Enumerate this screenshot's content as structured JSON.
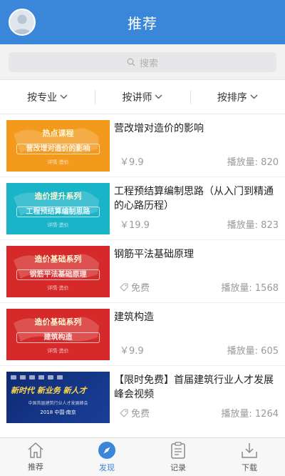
{
  "header": {
    "title": "推荐"
  },
  "search": {
    "placeholder": "搜索"
  },
  "filters": [
    {
      "label": "按专业"
    },
    {
      "label": "按讲师"
    },
    {
      "label": "按排序"
    }
  ],
  "courses": [
    {
      "title": "营改增对造价的影响",
      "price": "￥9.9",
      "plays": "播放量: 820",
      "thumb": {
        "series": "热点课程",
        "caption": "营改增对造价的影响",
        "footer": "详情·造价",
        "color": "#f39a1d"
      }
    },
    {
      "title": "工程预结算编制思路（从入门到精通的心路历程）",
      "price": "￥19.9",
      "plays": "播放量: 823",
      "thumb": {
        "series": "造价提升系列",
        "caption": "工程预结算编制思路",
        "footer": "详情·造价",
        "color": "#19b4c8"
      }
    },
    {
      "title": "钢筋平法基础原理",
      "price": "免费",
      "plays": "播放量: 1568",
      "thumb": {
        "series": "造价基础系列",
        "caption": "钢筋平法基础原理",
        "footer": "详情·造价",
        "color": "#d62a2a"
      }
    },
    {
      "title": "建筑构造",
      "price": "￥9.9",
      "plays": "播放量: 605",
      "thumb": {
        "series": "造价基础系列",
        "caption": "建筑构造",
        "footer": "详情·造价",
        "color": "#d62a2a"
      }
    },
    {
      "title": "【限时免费】首届建筑行业人才发展峰会视频",
      "price": "免费",
      "plays": "播放量: 1264",
      "thumb": {
        "headline": "新时代 新业务 新人才",
        "subtitle": "中国首届建筑行业人才发展峰会",
        "footer": "2018 中国·南京",
        "color": "#14307f"
      }
    }
  ],
  "tabbar": [
    {
      "label": "推荐",
      "icon": "home-icon"
    },
    {
      "label": "发现",
      "icon": "compass-icon",
      "active": true
    },
    {
      "label": "记录",
      "icon": "clipboard-icon"
    },
    {
      "label": "下载",
      "icon": "download-icon"
    }
  ],
  "colors": {
    "primary": "#3a86d9",
    "muted": "#9a9a9a"
  }
}
